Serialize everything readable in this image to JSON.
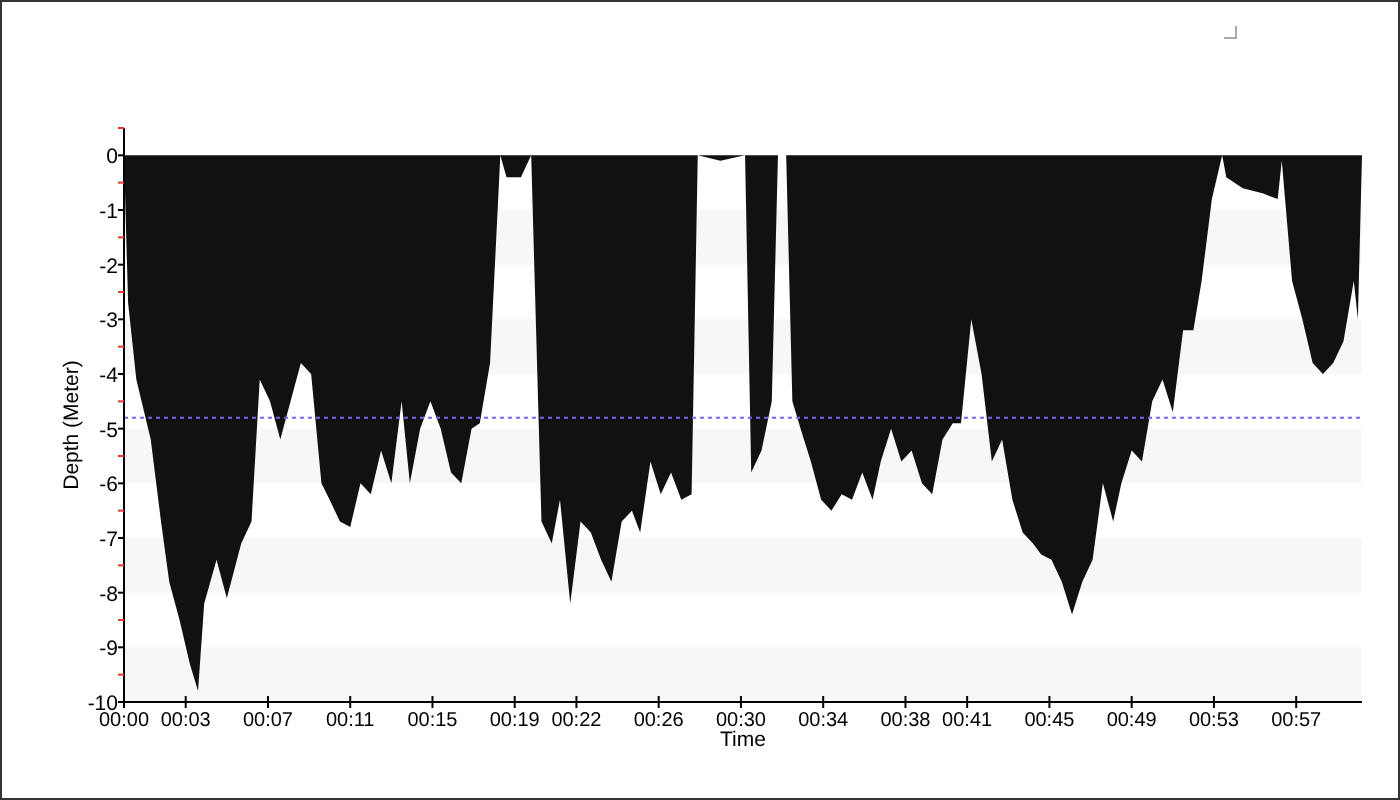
{
  "chart_data": {
    "type": "area",
    "xlabel": "Time",
    "ylabel": "Depth (Meter)",
    "x": [
      0,
      0.2,
      0.6,
      1.3,
      1.8,
      2.2,
      2.7,
      3.2,
      3.6,
      3.9,
      4.5,
      5.0,
      5.7,
      6.2,
      6.6,
      7.1,
      7.6,
      8.1,
      8.6,
      9.1,
      9.6,
      10.0,
      10.5,
      11.0,
      11.5,
      12.0,
      12.5,
      13.0,
      13.5,
      13.9,
      14.4,
      14.9,
      15.4,
      15.9,
      16.4,
      16.9,
      17.3,
      17.8,
      18.3,
      18.6,
      19.3,
      19.8,
      20.3,
      20.8,
      21.2,
      21.7,
      22.2,
      22.7,
      23.2,
      23.7,
      24.2,
      24.7,
      25.1,
      25.6,
      26.1,
      26.6,
      27.1,
      27.6,
      27.9,
      29.0,
      30.2,
      30.5,
      31.0,
      31.5,
      31.8,
      32.2,
      32.5,
      32.9,
      33.4,
      33.9,
      34.4,
      34.9,
      35.4,
      35.9,
      36.4,
      36.8,
      37.3,
      37.8,
      38.3,
      38.8,
      39.3,
      39.8,
      40.3,
      40.7,
      41.2,
      41.7,
      42.2,
      42.7,
      43.2,
      43.7,
      44.2,
      44.6,
      45.1,
      45.6,
      46.1,
      46.6,
      47.1,
      47.6,
      48.1,
      48.5,
      49.0,
      49.5,
      50.0,
      50.5,
      51.0,
      51.5,
      52.0,
      52.4,
      52.9,
      53.4,
      53.6,
      54.4,
      55.4,
      56.1,
      56.3,
      56.8,
      57.3,
      57.8,
      58.3,
      58.8,
      59.3,
      59.8,
      60.0,
      60.2
    ],
    "series": [
      {
        "color": "#111111",
        "values": [
          0,
          -2.7,
          -4.1,
          -5.2,
          -6.7,
          -7.8,
          -8.5,
          -9.3,
          -9.8,
          -8.2,
          -7.4,
          -8.1,
          -7.1,
          -6.7,
          -4.1,
          -4.5,
          -5.2,
          -4.5,
          -3.8,
          -4.0,
          -6.0,
          -6.3,
          -6.7,
          -6.8,
          -6.0,
          -6.2,
          -5.4,
          -6.0,
          -4.5,
          -6.0,
          -5.0,
          -4.5,
          -5.0,
          -5.8,
          -6.0,
          -5.0,
          -4.9,
          -3.8,
          0,
          -0.4,
          -0.4,
          0,
          -6.7,
          -7.1,
          -6.3,
          -8.2,
          -6.7,
          -6.9,
          -7.4,
          -7.8,
          -6.7,
          -6.5,
          -6.9,
          -5.6,
          -6.2,
          -5.8,
          -6.3,
          -6.2,
          0,
          -0.1,
          0,
          -5.8,
          -5.4,
          -4.5,
          0,
          0,
          -4.5,
          -5.0,
          -5.6,
          -6.3,
          -6.5,
          -6.2,
          -6.3,
          -5.8,
          -6.3,
          -5.6,
          -5.0,
          -5.6,
          -5.4,
          -6.0,
          -6.2,
          -5.2,
          -4.9,
          -4.9,
          -3.0,
          -4.0,
          -5.6,
          -5.2,
          -6.3,
          -6.9,
          -7.1,
          -7.3,
          -7.4,
          -7.8,
          -8.4,
          -7.8,
          -7.4,
          -6.0,
          -6.7,
          -6.0,
          -5.4,
          -5.6,
          -4.5,
          -4.1,
          -4.7,
          -3.2,
          -3.2,
          -2.3,
          -0.8,
          0,
          -0.4,
          -0.6,
          -0.7,
          -0.8,
          -0.1,
          -2.3,
          -3.0,
          -3.8,
          -4.0,
          -3.8,
          -3.4,
          -2.3,
          -3.0,
          0
        ]
      }
    ],
    "xlim": [
      0,
      60.2
    ],
    "ylim": [
      -10,
      0.5
    ],
    "xticks": [
      {
        "value": 0,
        "label": "00:00"
      },
      {
        "value": 3,
        "label": "00:03"
      },
      {
        "value": 7,
        "label": "00:07"
      },
      {
        "value": 11,
        "label": "00:11"
      },
      {
        "value": 15,
        "label": "00:15"
      },
      {
        "value": 19,
        "label": "00:19"
      },
      {
        "value": 22,
        "label": "00:22"
      },
      {
        "value": 26,
        "label": "00:26"
      },
      {
        "value": 30,
        "label": "00:30"
      },
      {
        "value": 34,
        "label": "00:34"
      },
      {
        "value": 38,
        "label": "00:38"
      },
      {
        "value": 41,
        "label": "00:41"
      },
      {
        "value": 45,
        "label": "00:45"
      },
      {
        "value": 49,
        "label": "00:49"
      },
      {
        "value": 53,
        "label": "00:53"
      },
      {
        "value": 57,
        "label": "00:57"
      }
    ],
    "yticks": [
      0,
      -1,
      -2,
      -3,
      -4,
      -5,
      -6,
      -7,
      -8,
      -9,
      -10
    ],
    "ref_lines": [
      {
        "axis": "y",
        "value": -4.8,
        "color": "#6a6aff"
      }
    ]
  }
}
